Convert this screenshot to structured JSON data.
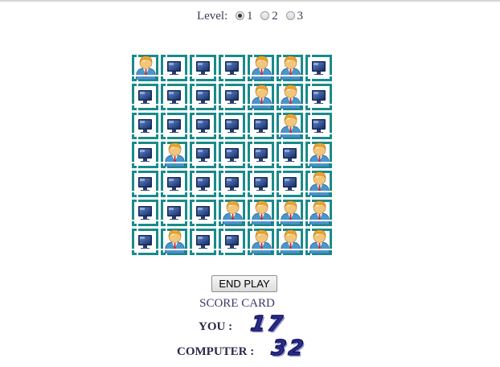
{
  "level": {
    "label": "Level:",
    "options": [
      "1",
      "2",
      "3"
    ],
    "selected": "1"
  },
  "board": {
    "rows": 7,
    "cols": 7,
    "cells": [
      [
        "person",
        "computer",
        "computer",
        "computer",
        "person",
        "person",
        "computer"
      ],
      [
        "computer",
        "computer",
        "computer",
        "computer",
        "person",
        "person",
        "computer"
      ],
      [
        "computer",
        "computer",
        "computer",
        "computer",
        "computer",
        "person",
        "computer"
      ],
      [
        "computer",
        "person",
        "computer",
        "computer",
        "computer",
        "computer",
        "person"
      ],
      [
        "computer",
        "computer",
        "computer",
        "computer",
        "computer",
        "computer",
        "person"
      ],
      [
        "computer",
        "computer",
        "computer",
        "person",
        "person",
        "person",
        "person"
      ],
      [
        "computer",
        "person",
        "computer",
        "computer",
        "person",
        "person",
        "person"
      ]
    ]
  },
  "controls": {
    "end_label": "END PLAY"
  },
  "score": {
    "title": "SCORE CARD",
    "you_label": "YOU :",
    "you_value": "17",
    "computer_label": "COMPUTER :",
    "computer_value": "32"
  },
  "colors": {
    "grid_border": "#1a8a8a",
    "score_digits": "#2c2c8e"
  }
}
